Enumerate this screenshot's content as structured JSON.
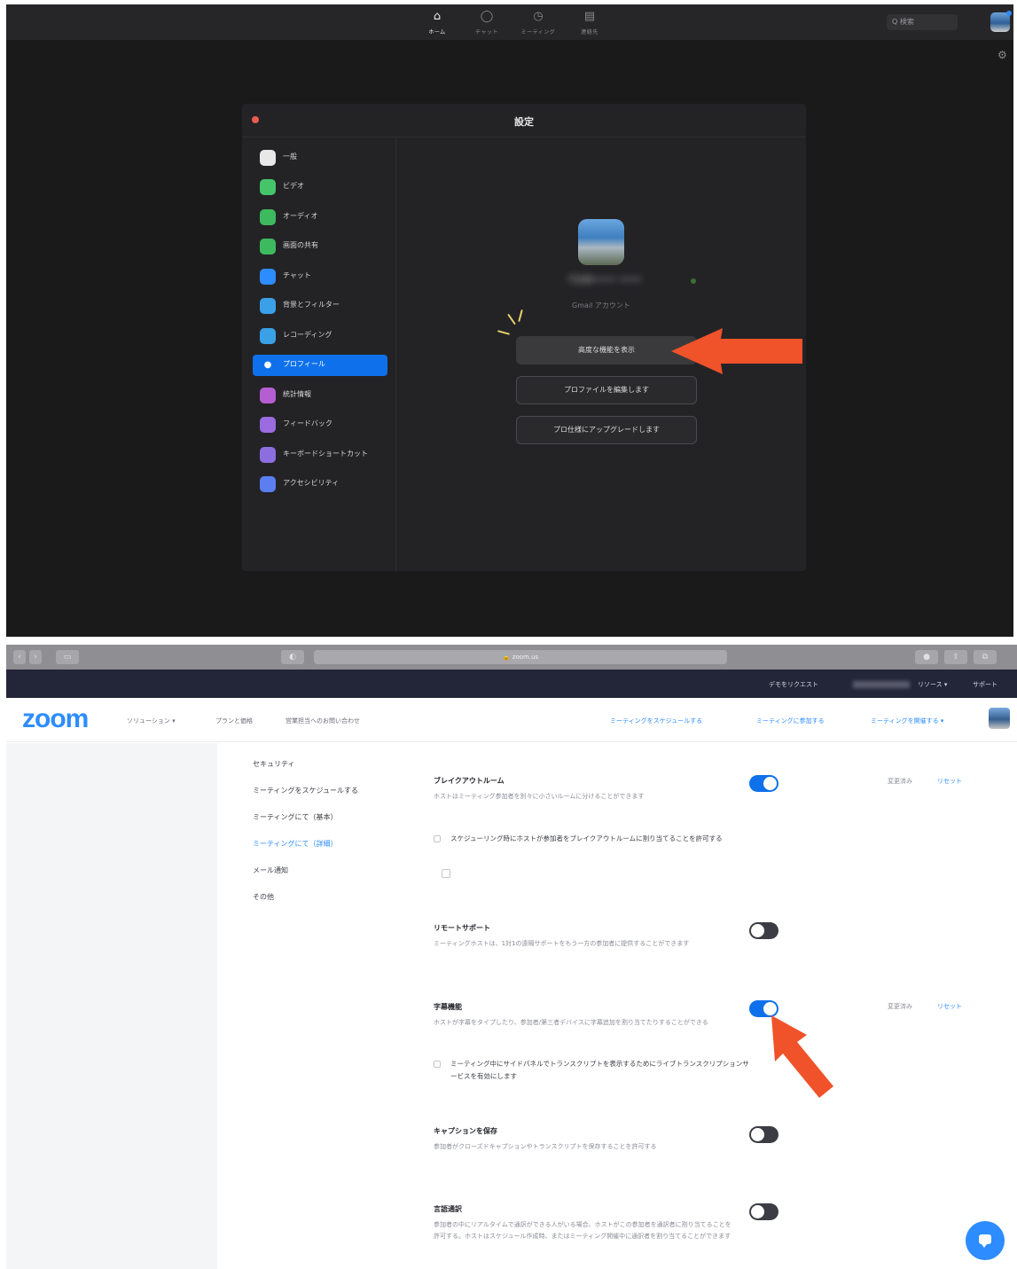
{
  "app": {
    "nav": [
      {
        "label": "ホーム",
        "icon": "home-icon"
      },
      {
        "label": "チャット",
        "icon": "chat-icon"
      },
      {
        "label": "ミーティング",
        "icon": "clock-icon"
      },
      {
        "label": "連絡先",
        "icon": "contacts-icon"
      }
    ],
    "search_placeholder": "Q 検索",
    "settings_title": "設定",
    "sidebar": [
      {
        "label": "一般",
        "color": "#e8e8e8"
      },
      {
        "label": "ビデオ",
        "color": "#46c46a"
      },
      {
        "label": "オーディオ",
        "color": "#3dba5e"
      },
      {
        "label": "画面の共有",
        "color": "#3dba5e"
      },
      {
        "label": "チャット",
        "color": "#2d8cff"
      },
      {
        "label": "背景とフィルター",
        "color": "#3aa0e8"
      },
      {
        "label": "レコーディング",
        "color": "#3aa0e8"
      },
      {
        "label": "プロフィール",
        "color": "#0e71eb"
      },
      {
        "label": "統計情報",
        "color": "#b45ed1"
      },
      {
        "label": "フィードバック",
        "color": "#9b6be0"
      },
      {
        "label": "キーボードショートカット",
        "color": "#8d6ee0"
      },
      {
        "label": "アクセシビリティ",
        "color": "#5b7ef0"
      }
    ],
    "profile": {
      "name": "7100•••• ••••",
      "account_type": "Gmail アカウント",
      "btn_advanced": "高度な機能を表示",
      "btn_edit": "プロファイルを編集します",
      "btn_upgrade": "プロ仕様にアップグレードします"
    }
  },
  "browser": {
    "url": "zoom.us"
  },
  "web": {
    "top_links": [
      "デモをリクエスト",
      "リソース ▾",
      "サポート"
    ],
    "logo": "zoom",
    "header_links": [
      "ソリューション ▾",
      "プランと価格",
      "営業担当へのお問い合わせ"
    ],
    "header_actions": [
      "ミーティングをスケジュールする",
      "ミーティングに参加する",
      "ミーティングを開催する ▾"
    ],
    "side_menu": [
      "セキュリティ",
      "ミーティングをスケジュールする",
      "ミーティングにて（基本）",
      "ミーティングにて（詳細）",
      "メール通知",
      "その他"
    ],
    "settings": [
      {
        "title": "ブレイクアウトルーム",
        "desc": "ホストはミーティング参加者を別々に小さいルームに分けることができます",
        "check": "スケジューリング時にホストが参加者をブレイクアウトルームに割り当てることを許可する",
        "state": "on",
        "modified": "変更済み",
        "reset": "リセット"
      },
      {
        "title": "リモートサポート",
        "desc": "ミーティングホストは、1対1の遠隔サポートをもう一方の参加者に提供することができます",
        "state": "off"
      },
      {
        "title": "字幕機能",
        "desc": "ホストが字幕をタイプしたり、参加者/第三者デバイスに字幕追加を割り当てたりすることができる",
        "check": "ミーティング中にサイドパネルでトランスクリプトを表示するためにライブトランスクリプションサービスを有効にします",
        "state": "on",
        "modified": "変更済み",
        "reset": "リセット"
      },
      {
        "title": "キャプションを保存",
        "desc": "参加者がクローズドキャプションやトランスクリプトを保存することを許可する",
        "state": "off"
      },
      {
        "title": "言語通訳",
        "desc": "参加者の中にリアルタイムで通訳ができる人がいる場合、ホストがこの参加者を通訳者に割り当てることを許可する。ホストはスケジュール作成時、またはミーティング開催中に通訳者を割り当てることができます",
        "state": "off"
      }
    ]
  },
  "colors": {
    "accent": "#2d8cff",
    "highlight_arrow": "#f0522a"
  }
}
